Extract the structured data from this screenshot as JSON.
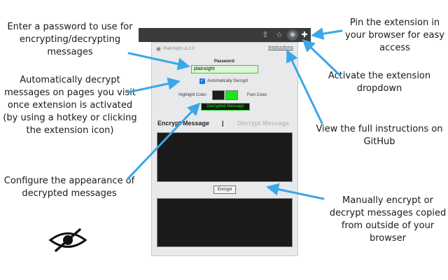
{
  "callouts": {
    "password": "Enter a password to use for encrypting/decrypting messages",
    "auto_decrypt": "Automatically decrypt messages on pages you visit once extension is activated (by using a hotkey or clicking the extension icon)",
    "appearance": "Configure the appearance of decrypted messages",
    "pin": "Pin the extension in your browser for easy access",
    "activate": "Activate the extension dropdown",
    "instructions": "View the full instructions on GitHub",
    "manual": "Manually encrypt or decrypt messages copied from outside of your browser"
  },
  "popup": {
    "title": "PlainSight v1.2.0",
    "instructions_link": "Instructions",
    "password_label": "Password:",
    "password_value": "plainsight",
    "auto_decrypt_label": "Automatically Decrypt",
    "auto_decrypt_checked": true,
    "highlight_color_label": "Highlight Color:",
    "font_color_label": "Font Color:",
    "highlight_color": "#1c1c1c",
    "font_color": "#19e619",
    "preview_text": "Decrypted Message",
    "tab_encrypt": "Encrypt Message",
    "tab_separator": "|",
    "tab_decrypt": "Decrypt Message",
    "encrypt_button": "Encrypt"
  },
  "toolbar": {
    "icons": [
      "share-icon",
      "star-icon",
      "plainsight-extension-icon",
      "puzzle-icon"
    ]
  },
  "colors": {
    "arrow": "#3aa7e8",
    "accent_green": "#19e619"
  }
}
